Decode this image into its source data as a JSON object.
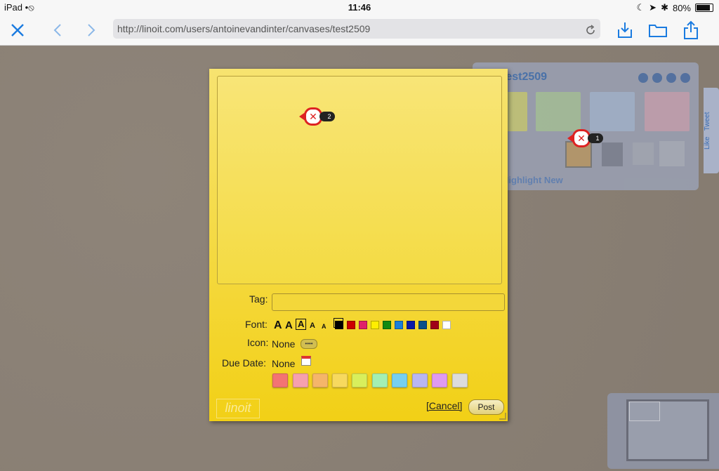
{
  "status_bar": {
    "device": "iPad",
    "time": "11:46",
    "battery": "80%"
  },
  "nav": {
    "url": "http://linoit.com/users/antoinevandinter/canvases/test2509"
  },
  "canvas_panel": {
    "title": "test2509",
    "new_label": "Highlight New"
  },
  "sidebar": {
    "like": "Like",
    "tweet": "Tweet"
  },
  "editor": {
    "tag_label": "Tag:",
    "tag_value": "",
    "font_label": "Font:",
    "icon_label": "Icon:",
    "icon_value": "None",
    "due_label": "Due Date:",
    "due_value": "None",
    "cancel_label": "[Cancel]",
    "post_label": "Post",
    "logo_text": "linoit",
    "font_colors": [
      "#000000",
      "#cc0000",
      "#e0206a",
      "#ffee00",
      "#118a11",
      "#1a7fd8",
      "#0a1aa8",
      "#0a4f8a",
      "#a00018",
      "#ffffff"
    ],
    "note_colors": [
      "#f37373",
      "#f6a0ae",
      "#f5b56a",
      "#f7d95e",
      "#d8ef5c",
      "#a3efb3",
      "#76cff0",
      "#b9b6f1",
      "#df9af0",
      "#dcdcdc"
    ]
  },
  "markers": [
    {
      "count": "2"
    },
    {
      "count": "1"
    }
  ],
  "colors": {
    "accent": "#1a7be0",
    "sticky": "#f2d016"
  }
}
